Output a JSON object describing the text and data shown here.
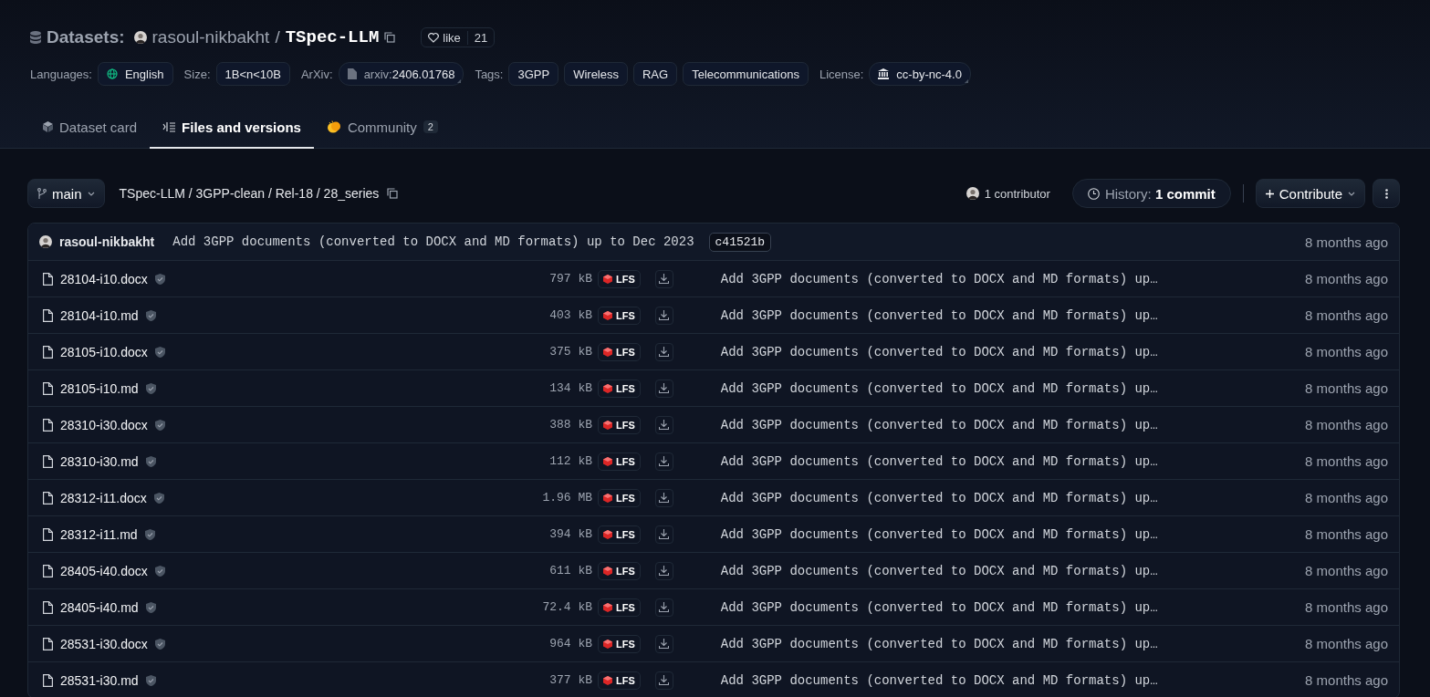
{
  "header": {
    "section": "Datasets:",
    "owner": "rasoul-nikbakht",
    "separator": "/",
    "repo": "TSpec-LLM",
    "like_label": "like",
    "like_count": "21"
  },
  "meta": [
    {
      "kind": "language",
      "label": "Languages:",
      "value": "English"
    },
    {
      "kind": "plain",
      "label": "Size:",
      "value": "1B<n<10B"
    },
    {
      "kind": "arxiv",
      "label": "ArXiv:",
      "prefix": "arxiv:",
      "value": "2406.01768"
    },
    {
      "kind": "tags",
      "label": "Tags:",
      "values": [
        "3GPP",
        "Wireless",
        "RAG",
        "Telecommunications"
      ]
    },
    {
      "kind": "license",
      "label": "License:",
      "value": "cc-by-nc-4.0"
    }
  ],
  "tabs": [
    {
      "kind": "card",
      "label": "Dataset card",
      "selected": false
    },
    {
      "kind": "files",
      "label": "Files and versions",
      "selected": true
    },
    {
      "kind": "community",
      "label": "Community",
      "count": "2",
      "selected": false
    }
  ],
  "toolbar": {
    "branch": "main",
    "path": "TSpec-LLM / 3GPP-clean / Rel-18 / 28_series",
    "contributors": "1 contributor",
    "history_label": "History:",
    "history_value": "1 commit",
    "contribute": "Contribute"
  },
  "last_commit": {
    "author": "rasoul-nikbakht",
    "message": "Add 3GPP documents (converted to DOCX and MD formats) up to Dec 2023",
    "hash": "c41521b",
    "time": "8 months ago"
  },
  "files": [
    {
      "name": "28104-i10.docx",
      "size": "797 kB",
      "lfs": "LFS",
      "message": "Add 3GPP documents (converted to DOCX and MD formats) up…",
      "time": "8 months ago"
    },
    {
      "name": "28104-i10.md",
      "size": "403 kB",
      "lfs": "LFS",
      "message": "Add 3GPP documents (converted to DOCX and MD formats) up…",
      "time": "8 months ago"
    },
    {
      "name": "28105-i10.docx",
      "size": "375 kB",
      "lfs": "LFS",
      "message": "Add 3GPP documents (converted to DOCX and MD formats) up…",
      "time": "8 months ago"
    },
    {
      "name": "28105-i10.md",
      "size": "134 kB",
      "lfs": "LFS",
      "message": "Add 3GPP documents (converted to DOCX and MD formats) up…",
      "time": "8 months ago"
    },
    {
      "name": "28310-i30.docx",
      "size": "388 kB",
      "lfs": "LFS",
      "message": "Add 3GPP documents (converted to DOCX and MD formats) up…",
      "time": "8 months ago"
    },
    {
      "name": "28310-i30.md",
      "size": "112 kB",
      "lfs": "LFS",
      "message": "Add 3GPP documents (converted to DOCX and MD formats) up…",
      "time": "8 months ago"
    },
    {
      "name": "28312-i11.docx",
      "size": "1.96 MB",
      "lfs": "LFS",
      "message": "Add 3GPP documents (converted to DOCX and MD formats) up…",
      "time": "8 months ago"
    },
    {
      "name": "28312-i11.md",
      "size": "394 kB",
      "lfs": "LFS",
      "message": "Add 3GPP documents (converted to DOCX and MD formats) up…",
      "time": "8 months ago"
    },
    {
      "name": "28405-i40.docx",
      "size": "611 kB",
      "lfs": "LFS",
      "message": "Add 3GPP documents (converted to DOCX and MD formats) up…",
      "time": "8 months ago"
    },
    {
      "name": "28405-i40.md",
      "size": "72.4 kB",
      "lfs": "LFS",
      "message": "Add 3GPP documents (converted to DOCX and MD formats) up…",
      "time": "8 months ago"
    },
    {
      "name": "28531-i30.docx",
      "size": "964 kB",
      "lfs": "LFS",
      "message": "Add 3GPP documents (converted to DOCX and MD formats) up…",
      "time": "8 months ago"
    },
    {
      "name": "28531-i30.md",
      "size": "377 kB",
      "lfs": "LFS",
      "message": "Add 3GPP documents (converted to DOCX and MD formats) up…",
      "time": "8 months ago"
    }
  ]
}
